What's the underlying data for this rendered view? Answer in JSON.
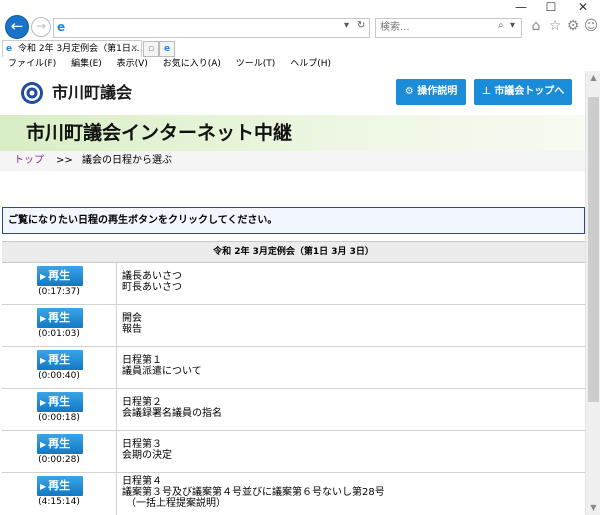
{
  "browser": {
    "address_value": "",
    "search_placeholder": "検索...",
    "tab_title": "令和 2年 3月定例会（第1日...",
    "menu": [
      "ファイル(F)",
      "編集(E)",
      "表示(V)",
      "お気に入り(A)",
      "ツール(T)",
      "ヘルプ(H)"
    ]
  },
  "site": {
    "name": "市川町議会",
    "btn_guide": "操作説明",
    "btn_top": "市議会トップへ",
    "page_title": "市川町議会インターネット中継",
    "breadcrumb_top": "トップ",
    "breadcrumb_sep": ">>",
    "breadcrumb_current": "議会の日程から選ぶ"
  },
  "instruction": "ご覧になりたい日程の再生ボタンをクリックしてください。",
  "session_header": "令和 2年 3月定例会（第1日 3月 3日）",
  "play_label": "再生",
  "rows": [
    {
      "duration": "(0:17:37)",
      "lines": [
        "議長あいさつ",
        "町長あいさつ"
      ]
    },
    {
      "duration": "(0:01:03)",
      "lines": [
        "開会",
        "報告"
      ]
    },
    {
      "duration": "(0:00:40)",
      "lines": [
        "日程第１",
        "議員派遣について"
      ]
    },
    {
      "duration": "(0:00:18)",
      "lines": [
        "日程第２",
        "会議録署名議員の指名"
      ]
    },
    {
      "duration": "(0:00:28)",
      "lines": [
        "日程第３",
        "会期の決定"
      ]
    },
    {
      "duration": "(4:15:14)",
      "lines": [
        "日程第４",
        "議案第３号及び議案第４号並びに議案第６号ないし第28号",
        "（一括上程提案説明）"
      ]
    }
  ]
}
